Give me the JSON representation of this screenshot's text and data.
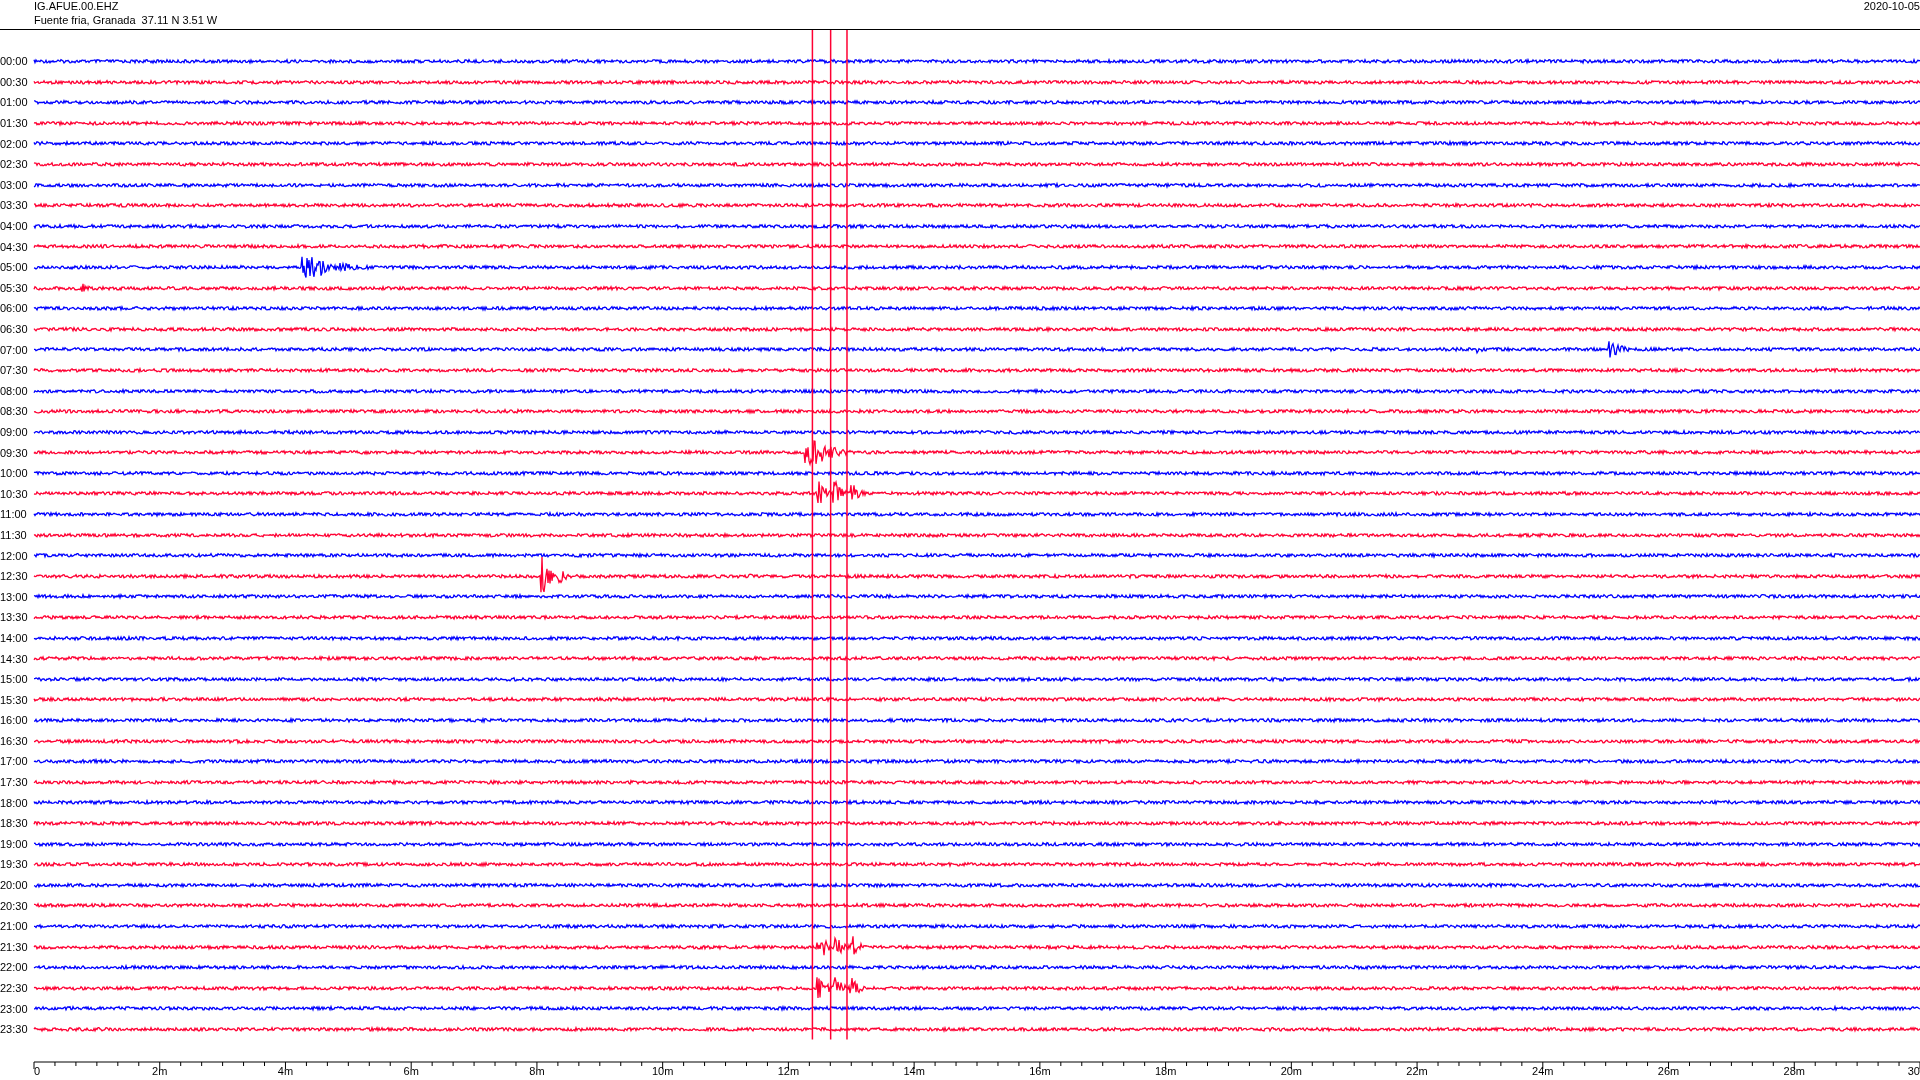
{
  "header": {
    "station": "IG.AFUE.00.EHZ",
    "location": "Fuente fria, Granada  37.11 N 3.51 W",
    "date": "2020-10-05"
  },
  "rows": [
    {
      "label": "00:00",
      "color": "#0000ff"
    },
    {
      "label": "00:30",
      "color": "#ff0033"
    },
    {
      "label": "01:00",
      "color": "#0000ff"
    },
    {
      "label": "01:30",
      "color": "#ff0033"
    },
    {
      "label": "02:00",
      "color": "#0000ff"
    },
    {
      "label": "02:30",
      "color": "#ff0033"
    },
    {
      "label": "03:00",
      "color": "#0000ff"
    },
    {
      "label": "03:30",
      "color": "#ff0033"
    },
    {
      "label": "04:00",
      "color": "#0000ff"
    },
    {
      "label": "04:30",
      "color": "#ff0033"
    },
    {
      "label": "05:00",
      "color": "#0000ff"
    },
    {
      "label": "05:30",
      "color": "#ff0033"
    },
    {
      "label": "06:00",
      "color": "#0000ff"
    },
    {
      "label": "06:30",
      "color": "#ff0033"
    },
    {
      "label": "07:00",
      "color": "#0000ff"
    },
    {
      "label": "07:30",
      "color": "#ff0033"
    },
    {
      "label": "08:00",
      "color": "#0000ff"
    },
    {
      "label": "08:30",
      "color": "#ff0033"
    },
    {
      "label": "09:00",
      "color": "#0000ff"
    },
    {
      "label": "09:30",
      "color": "#ff0033"
    },
    {
      "label": "10:00",
      "color": "#0000ff"
    },
    {
      "label": "10:30",
      "color": "#ff0033"
    },
    {
      "label": "11:00",
      "color": "#0000ff"
    },
    {
      "label": "11:30",
      "color": "#ff0033"
    },
    {
      "label": "12:00",
      "color": "#0000ff"
    },
    {
      "label": "12:30",
      "color": "#ff0033"
    },
    {
      "label": "13:00",
      "color": "#0000ff"
    },
    {
      "label": "13:30",
      "color": "#ff0033"
    },
    {
      "label": "14:00",
      "color": "#0000ff"
    },
    {
      "label": "14:30",
      "color": "#ff0033"
    },
    {
      "label": "15:00",
      "color": "#0000ff"
    },
    {
      "label": "15:30",
      "color": "#ff0033"
    },
    {
      "label": "16:00",
      "color": "#0000ff"
    },
    {
      "label": "16:30",
      "color": "#ff0033"
    },
    {
      "label": "17:00",
      "color": "#0000ff"
    },
    {
      "label": "17:30",
      "color": "#ff0033"
    },
    {
      "label": "18:00",
      "color": "#0000ff"
    },
    {
      "label": "18:30",
      "color": "#ff0033"
    },
    {
      "label": "19:00",
      "color": "#0000ff"
    },
    {
      "label": "19:30",
      "color": "#ff0033"
    },
    {
      "label": "20:00",
      "color": "#0000ff"
    },
    {
      "label": "20:30",
      "color": "#ff0033"
    },
    {
      "label": "21:00",
      "color": "#0000ff"
    },
    {
      "label": "21:30",
      "color": "#ff0033"
    },
    {
      "label": "22:00",
      "color": "#0000ff"
    },
    {
      "label": "22:30",
      "color": "#ff0033"
    },
    {
      "label": "23:00",
      "color": "#0000ff"
    },
    {
      "label": "23:30",
      "color": "#ff0033"
    }
  ],
  "axis": {
    "labels": [
      "0",
      "2m",
      "4m",
      "6m",
      "8m",
      "10m",
      "12m",
      "14m",
      "16m",
      "18m",
      "20m",
      "22m",
      "24m",
      "26m",
      "28m",
      "30"
    ]
  }
}
